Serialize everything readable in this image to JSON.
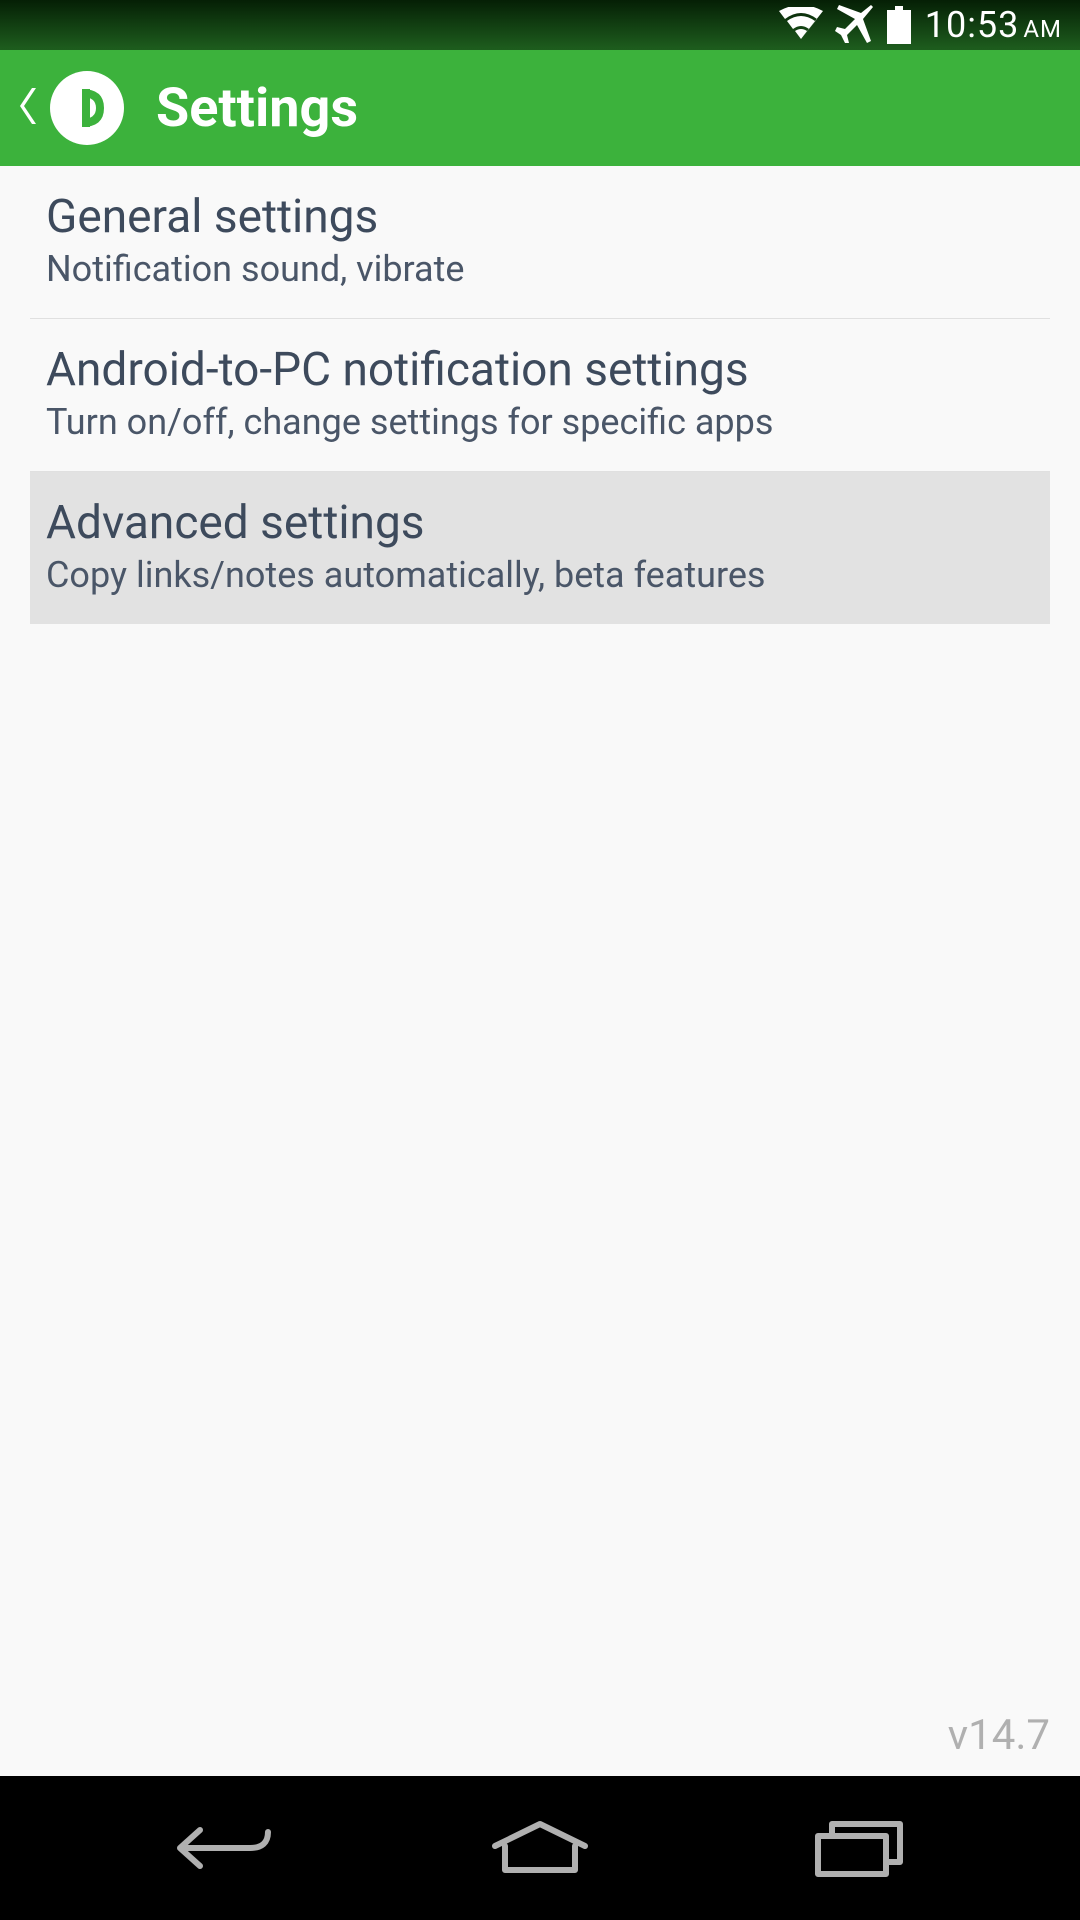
{
  "statusBar": {
    "time": "10:53",
    "ampm": "AM"
  },
  "actionBar": {
    "title": "Settings",
    "appIconLetter": "D"
  },
  "settings": {
    "items": [
      {
        "title": "General settings",
        "subtitle": "Notification sound, vibrate",
        "selected": false
      },
      {
        "title": "Android-to-PC notification settings",
        "subtitle": "Turn on/off, change settings for specific apps",
        "selected": false
      },
      {
        "title": "Advanced settings",
        "subtitle": "Copy links/notes automatically, beta features",
        "selected": true
      }
    ]
  },
  "version": "v14.7"
}
